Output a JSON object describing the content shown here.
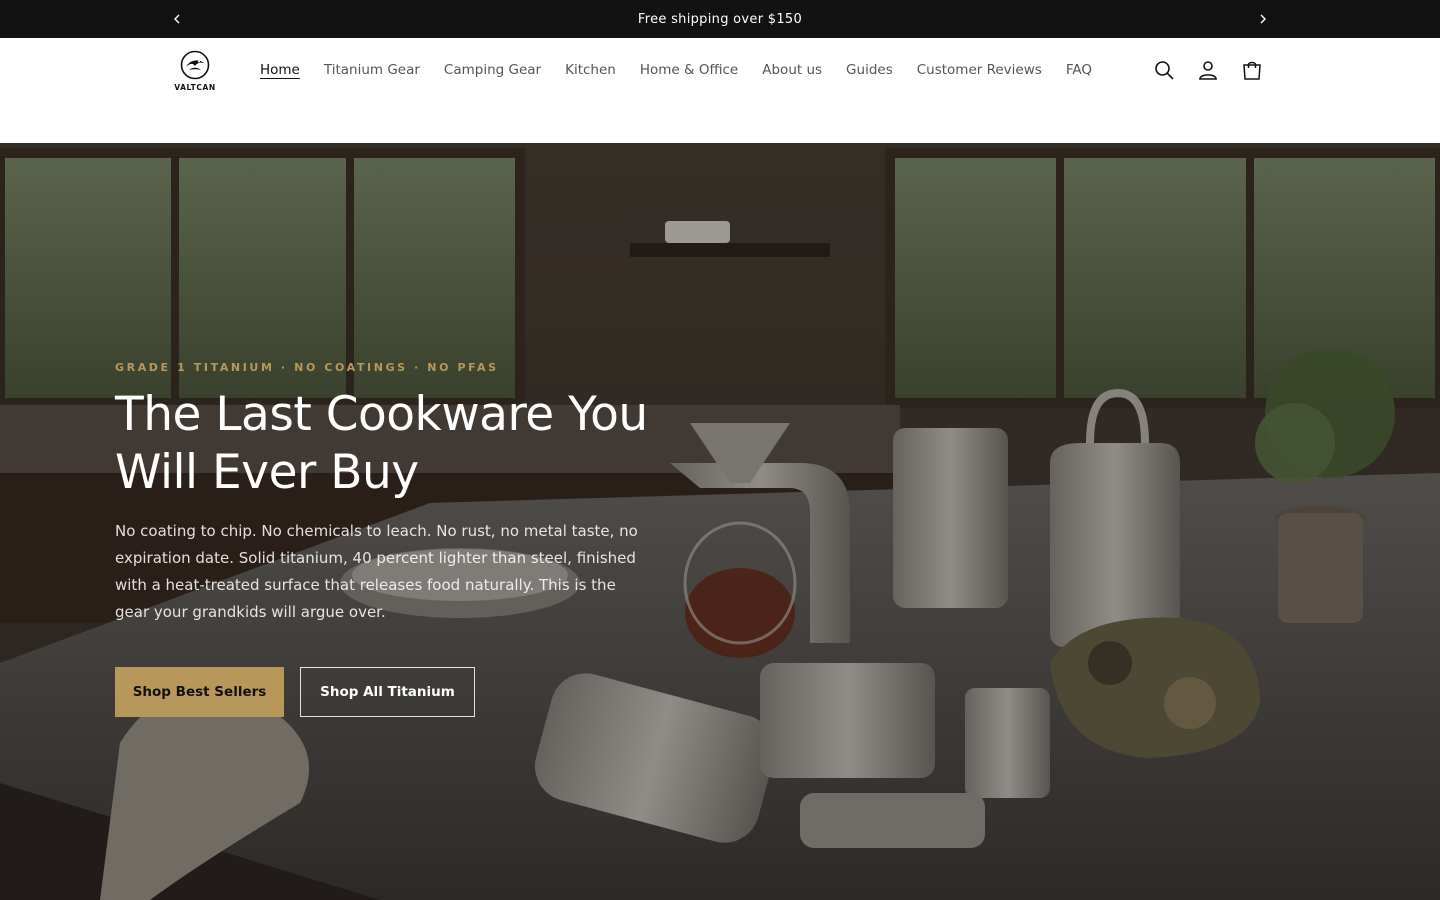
{
  "announcement": {
    "text": "Free shipping over $150",
    "prev_icon": "chevron-left-icon",
    "next_icon": "chevron-right-icon"
  },
  "header": {
    "logo_text": "VALTCAN",
    "nav": [
      {
        "label": "Home",
        "active": true
      },
      {
        "label": "Titanium Gear",
        "active": false
      },
      {
        "label": "Camping Gear",
        "active": false
      },
      {
        "label": "Kitchen",
        "active": false
      },
      {
        "label": "Home & Office",
        "active": false
      },
      {
        "label": "About us",
        "active": false
      },
      {
        "label": "Guides",
        "active": false
      },
      {
        "label": "Customer Reviews",
        "active": false
      },
      {
        "label": "FAQ",
        "active": false
      }
    ],
    "icons": [
      "search-icon",
      "account-icon",
      "cart-icon"
    ]
  },
  "hero": {
    "eyebrow": "GRADE 1 TITANIUM · NO COATINGS · NO PFAS",
    "headline": "The Last Cookware You Will Ever Buy",
    "subtext": "No coating to chip. No chemicals to leach. No rust, no metal taste, no expiration date. Solid titanium, 40 percent lighter than steel, finished with a heat-treated surface that releases food naturally. This is the gear your grandkids will argue over.",
    "primary_cta": "Shop Best Sellers",
    "secondary_cta": "Shop All Titanium"
  },
  "colors": {
    "accent": "#b8975a",
    "announcement_bg": "#121212",
    "text_dark": "#121212"
  }
}
